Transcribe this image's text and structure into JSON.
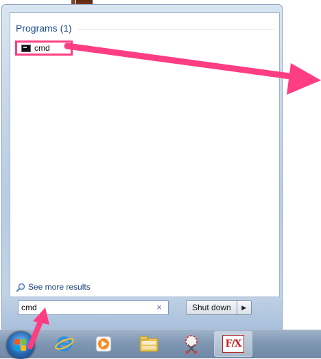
{
  "results": {
    "programs_header": "Programs (1)",
    "items": [
      {
        "label": "cmd",
        "icon": "command-prompt-icon"
      }
    ],
    "see_more_label": "See more results"
  },
  "search": {
    "value": "cmd",
    "clear_icon": "×"
  },
  "shutdown": {
    "label": "Shut down",
    "arrow_glyph": "▶"
  },
  "taskbar": {
    "pinned": [
      {
        "name": "internet-explorer-icon"
      },
      {
        "name": "media-player-icon"
      },
      {
        "name": "file-explorer-icon"
      },
      {
        "name": "snipping-tool-icon"
      },
      {
        "name": "fx-app-icon",
        "label": "F/X"
      }
    ]
  },
  "colors": {
    "highlight": "#ff3d82",
    "header_text": "#1e4f8f"
  }
}
